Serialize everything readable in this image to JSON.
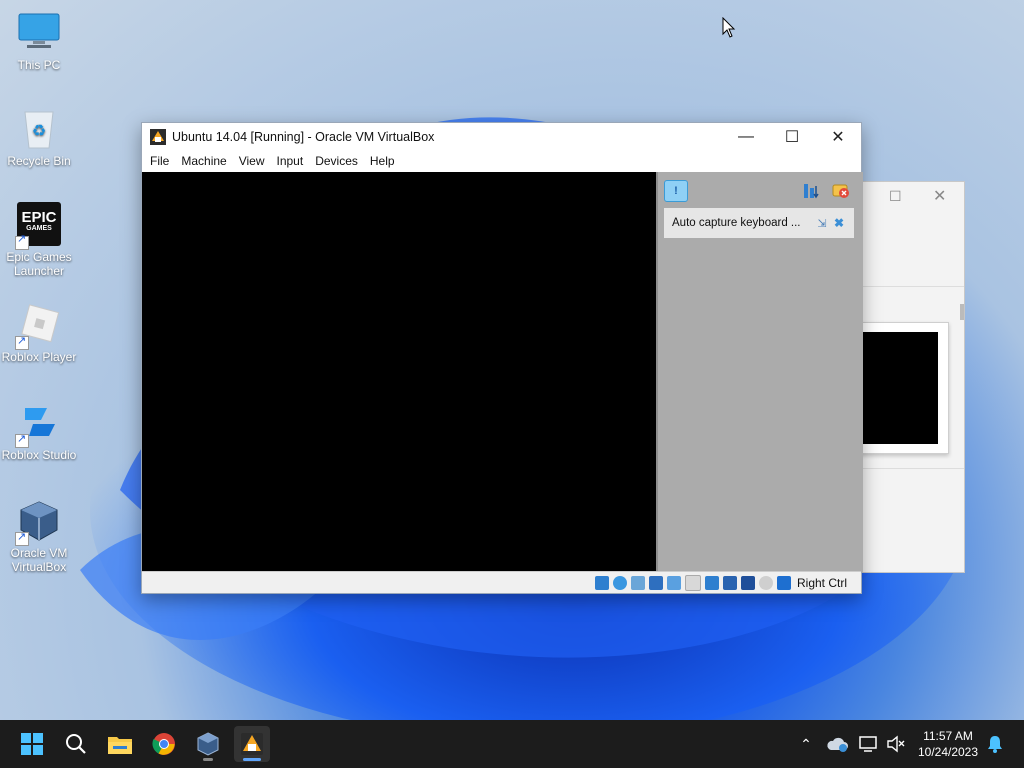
{
  "desktop": {
    "icons": [
      {
        "label": "This PC"
      },
      {
        "label": "Recycle Bin"
      },
      {
        "label": "Epic Games Launcher",
        "logo_line1": "EPIC",
        "logo_line2": "GAMES"
      },
      {
        "label": "Roblox Player"
      },
      {
        "label": "Roblox Studio"
      },
      {
        "label": "Oracle VM VirtualBox"
      }
    ]
  },
  "vbox_window": {
    "title": "Ubuntu 14.04 [Running] - Oracle VM VirtualBox",
    "menu": [
      "File",
      "Machine",
      "View",
      "Input",
      "Devices",
      "Help"
    ],
    "notification": {
      "text": "Auto capture keyboard ..."
    },
    "status": {
      "host_key": "Right Ctrl"
    }
  },
  "taskbar": {
    "apps": [
      "start-icon",
      "search-icon",
      "file-explorer-icon",
      "chrome-icon",
      "virtualbox-icon",
      "virtualbox-vm-icon"
    ],
    "clock": {
      "time": "11:57 AM",
      "date": "10/24/2023"
    }
  },
  "colors": {
    "accent": "#60a5fa",
    "taskbar": "#1c1c1c",
    "notif_panel": "#ababab"
  }
}
